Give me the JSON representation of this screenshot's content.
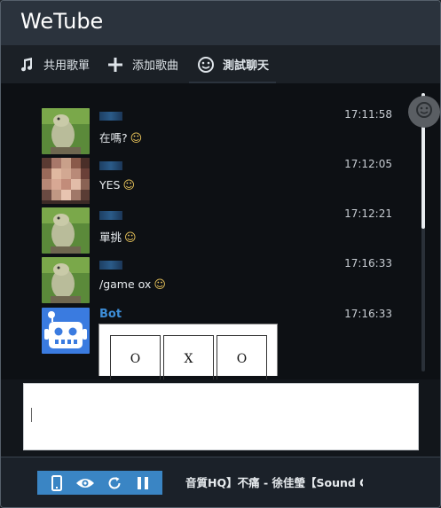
{
  "app": {
    "title": "WeTube"
  },
  "tabs": [
    {
      "label": "共用歌單",
      "icon": "music-note-icon"
    },
    {
      "label": "添加歌曲",
      "icon": "plus-icon"
    },
    {
      "label": "測試聊天",
      "icon": "smiley-icon",
      "active": true
    }
  ],
  "messages": [
    {
      "text": "在嗎?",
      "time": "17:11:58",
      "avatar": "frog-avatar",
      "emoji": "☺"
    },
    {
      "text": "YES",
      "time": "17:12:05",
      "avatar": "pixelated-avatar",
      "emoji": "☺"
    },
    {
      "text": "單挑",
      "time": "17:12:21",
      "avatar": "frog-avatar",
      "emoji": "☺"
    },
    {
      "text": "/game ox",
      "time": "17:16:33",
      "avatar": "frog-avatar",
      "emoji": "☺"
    },
    {
      "username": "Bot",
      "time": "17:16:33",
      "avatar": "robot-avatar",
      "board": [
        "O",
        "X",
        "O"
      ]
    }
  ],
  "footer": {
    "now_playing": "音質HQ】不痛 - 徐佳瑩【Sound C"
  },
  "colors": {
    "accent": "#3a85c4",
    "bot_name": "#3d8ed8",
    "emoji": "#e8c35a"
  }
}
